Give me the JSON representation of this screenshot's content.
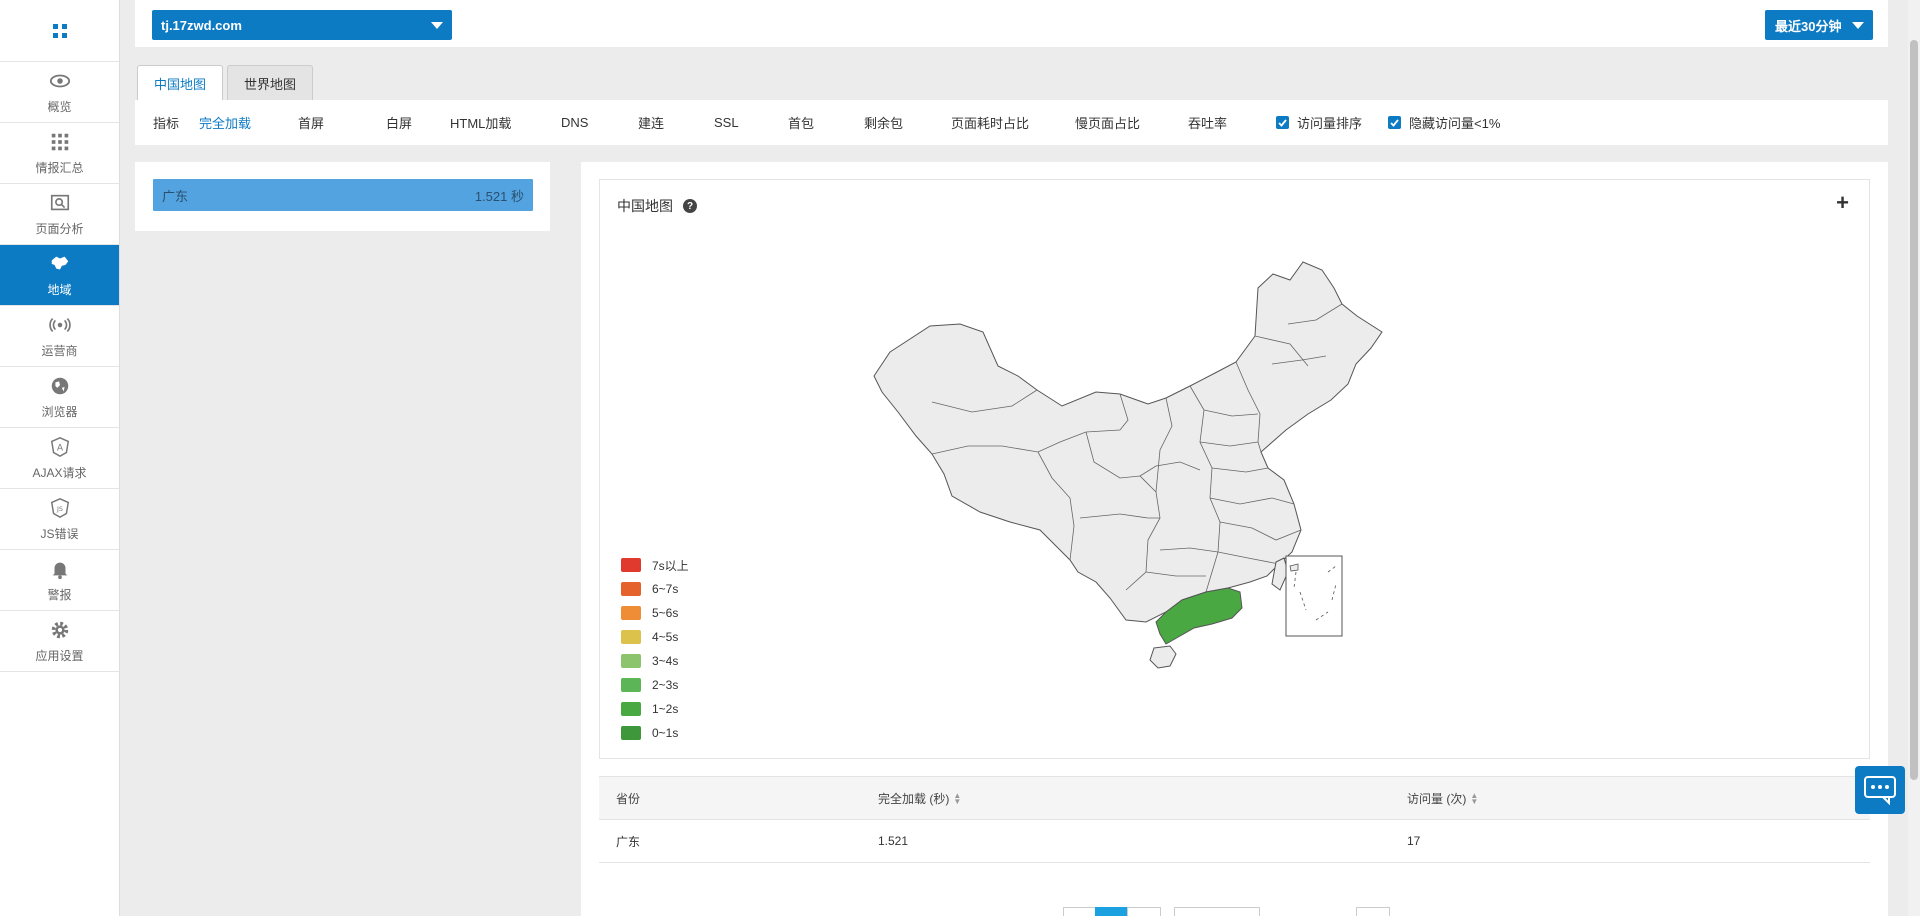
{
  "sidebar": {
    "items": [
      {
        "label": "概览",
        "icon": "eye-icon"
      },
      {
        "label": "情报汇总",
        "icon": "grid-icon"
      },
      {
        "label": "页面分析",
        "icon": "page-search-icon"
      },
      {
        "label": "地域",
        "icon": "map-icon",
        "active": true
      },
      {
        "label": "运营商",
        "icon": "signal-icon"
      },
      {
        "label": "浏览器",
        "icon": "globe-icon"
      },
      {
        "label": "AJAX请求",
        "icon": "ajax-icon"
      },
      {
        "label": "JS错误",
        "icon": "js-icon"
      },
      {
        "label": "警报",
        "icon": "bell-icon"
      },
      {
        "label": "应用设置",
        "icon": "gear-icon"
      }
    ]
  },
  "header": {
    "domain": "tj.17zwd.com",
    "time_range": "最近30分钟"
  },
  "tabs": [
    {
      "label": "中国地图",
      "active": true
    },
    {
      "label": "世界地图",
      "active": false
    }
  ],
  "metrics": {
    "label": "指标",
    "items": [
      "完全加载",
      "首屏",
      "白屏",
      "HTML加载",
      "DNS",
      "建连",
      "SSL",
      "首包",
      "剩余包",
      "页面耗时占比",
      "慢页面占比",
      "吞吐率"
    ],
    "active": "完全加载",
    "checkboxes": [
      {
        "label": "访问量排序",
        "checked": true
      },
      {
        "label": "隐藏访问量<1%",
        "checked": true
      }
    ]
  },
  "ranking": {
    "items": [
      {
        "province": "广东",
        "value": "1.521 秒"
      }
    ]
  },
  "map_card": {
    "title": "中国地图",
    "highlight_color": "#4aa843",
    "legend": [
      {
        "label": "7s以上",
        "color": "#e03a2f"
      },
      {
        "label": "6~7s",
        "color": "#e5622c"
      },
      {
        "label": "5~6s",
        "color": "#ef8c36"
      },
      {
        "label": "4~5s",
        "color": "#dcc24a"
      },
      {
        "label": "3~4s",
        "color": "#8cc46e"
      },
      {
        "label": "2~3s",
        "color": "#5cb556"
      },
      {
        "label": "1~2s",
        "color": "#4aa843"
      },
      {
        "label": "0~1s",
        "color": "#3f973b"
      }
    ]
  },
  "table": {
    "headers": [
      "省份",
      "完全加载 (秒)",
      "访问量 (次)"
    ],
    "rows": [
      [
        "广东",
        "1.521",
        "17"
      ]
    ]
  }
}
